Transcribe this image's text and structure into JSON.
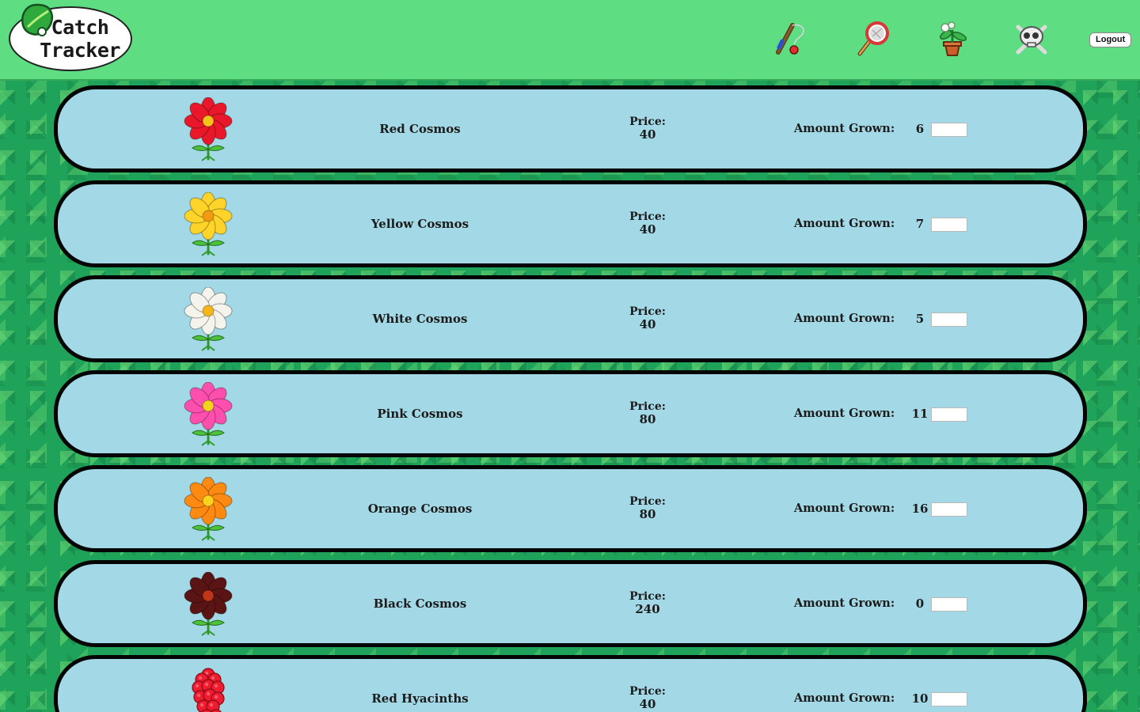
{
  "header": {
    "logo_line1": "Catch",
    "logo_line2": "Tracker",
    "nav_icons": [
      "fishing-rod-icon",
      "bug-net-icon",
      "potted-plant-icon",
      "fossil-skull-icon"
    ],
    "logout_label": "Logout"
  },
  "labels": {
    "price": "Price:",
    "amount_grown": "Amount Grown:"
  },
  "colors": {
    "header_bg": "#5fdd82",
    "row_bg": "#a3d9e6",
    "row_border": "#050505",
    "page_bg": "#1fa35a"
  },
  "flowers": [
    {
      "name": "Red Cosmos",
      "price": "40",
      "amount": "6",
      "petal_color": "#e8182a",
      "center_color": "#f5c21b",
      "icon": "red-cosmos-icon"
    },
    {
      "name": "Yellow Cosmos",
      "price": "40",
      "amount": "7",
      "petal_color": "#ffd42a",
      "center_color": "#f29b12",
      "icon": "yellow-cosmos-icon"
    },
    {
      "name": "White Cosmos",
      "price": "40",
      "amount": "5",
      "petal_color": "#f4f4ec",
      "center_color": "#f5b51b",
      "icon": "white-cosmos-icon"
    },
    {
      "name": "Pink Cosmos",
      "price": "80",
      "amount": "11",
      "petal_color": "#ff4fae",
      "center_color": "#f5d21b",
      "icon": "pink-cosmos-icon"
    },
    {
      "name": "Orange Cosmos",
      "price": "80",
      "amount": "16",
      "petal_color": "#ff8a12",
      "center_color": "#ffd21b",
      "icon": "orange-cosmos-icon"
    },
    {
      "name": "Black Cosmos",
      "price": "240",
      "amount": "0",
      "petal_color": "#5a1414",
      "center_color": "#c0361a",
      "icon": "black-cosmos-icon"
    },
    {
      "name": "Red Hyacinths",
      "price": "40",
      "amount": "10",
      "petal_color": "#ee1c30",
      "center_color": "#ff5a66",
      "icon": "red-hyacinth-icon"
    }
  ]
}
